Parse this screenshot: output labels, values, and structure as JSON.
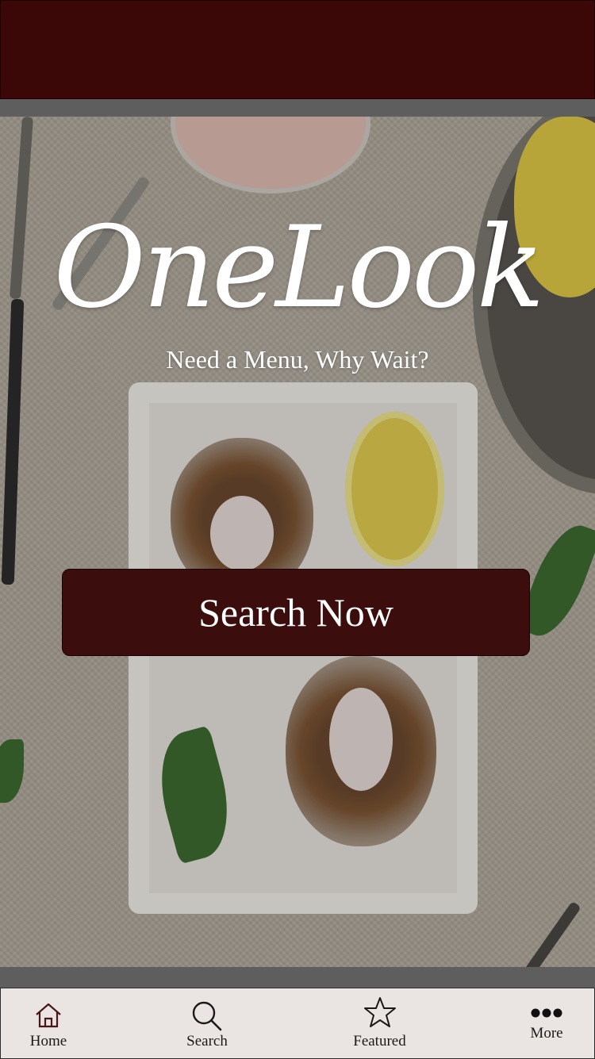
{
  "app": {
    "title": "OneLook",
    "tagline": "Need a Menu, Why Wait?"
  },
  "actions": {
    "search_label": "Search Now"
  },
  "tabbar": {
    "items": [
      {
        "label": "Home",
        "icon": "home-icon"
      },
      {
        "label": "Search",
        "icon": "search-icon"
      },
      {
        "label": "Featured",
        "icon": "star-icon"
      },
      {
        "label": "More",
        "icon": "more-dots-icon"
      }
    ]
  },
  "colors": {
    "brand": "#3c0707",
    "button": "#3c0d0d",
    "tabbar_bg": "#eae4e3"
  }
}
